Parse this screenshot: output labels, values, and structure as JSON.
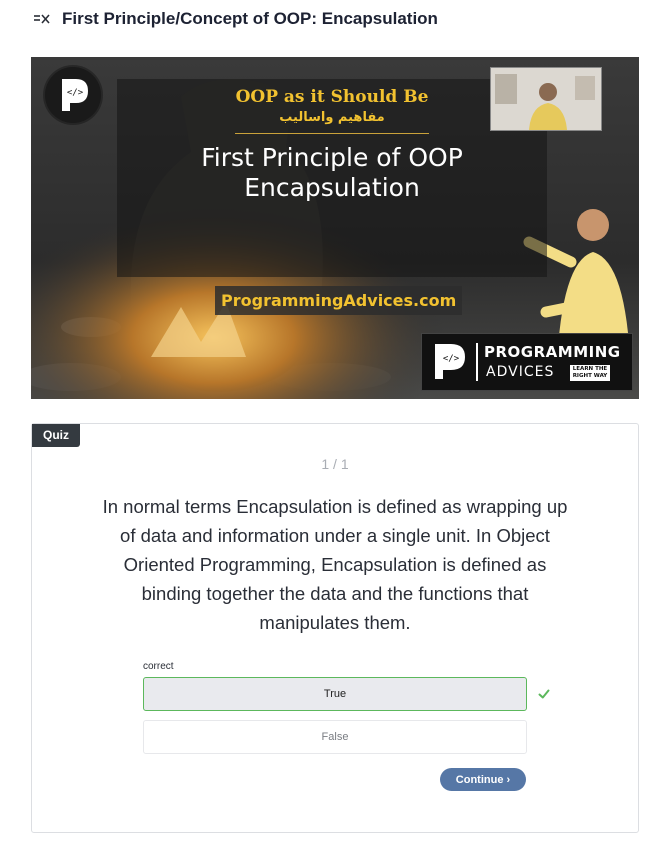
{
  "lesson": {
    "icon": "lesson-list-icon",
    "title": "First Principle/Concept of OOP: Encapsulation"
  },
  "video": {
    "line1": "OOP as it Should Be",
    "line2_arabic": "مفاهيم واساليب",
    "heading_line1": "First Principle of OOP",
    "heading_line2": "Encapsulation",
    "website": "ProgrammingAdvices.com",
    "brand_word1": "PROGRAMMING",
    "brand_word2": "ADVICES",
    "brand_tagline": "LEARN THE RIGHT WAY",
    "accent_color": "#f2c230"
  },
  "quiz": {
    "badge": "Quiz",
    "counter": "1 / 1",
    "question": "In normal terms Encapsulation is defined as wrapping up of data and information under a single unit. In Object Oriented Programming, Encapsulation is defined as binding together the data and the functions that manipulates them.",
    "result_label": "correct",
    "options": [
      {
        "label": "True",
        "selected": true,
        "correct": true
      },
      {
        "label": "False",
        "selected": false,
        "correct": false
      }
    ],
    "continue_label": "Continue ›",
    "colors": {
      "correct": "#5cb85c",
      "button": "#5677a6",
      "badge": "#343a40"
    }
  }
}
